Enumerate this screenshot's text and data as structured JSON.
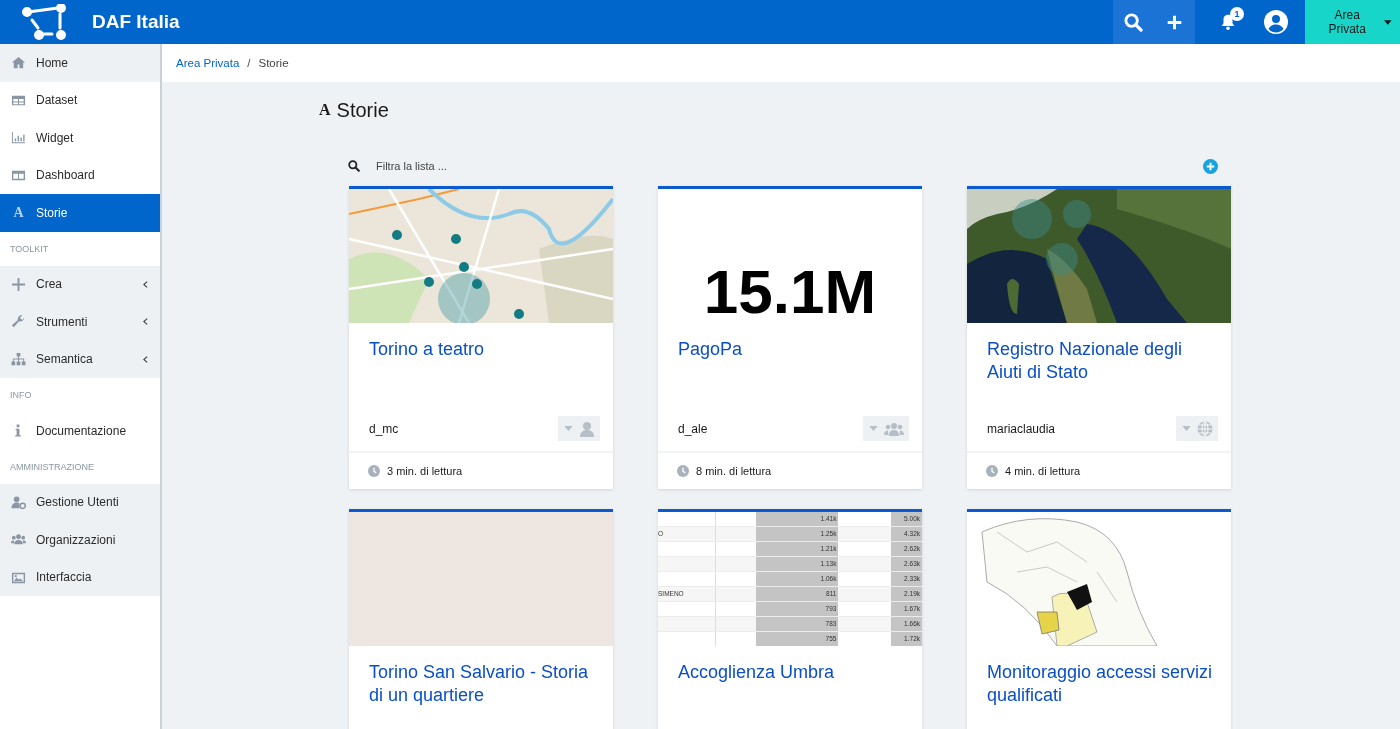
{
  "topbar": {
    "brand": "DAF Italia",
    "notifications": "1",
    "area_menu": "Area Privata"
  },
  "sidebar": {
    "sections": [
      {
        "items": [
          {
            "label": "Home",
            "selected": false,
            "highlighted": true,
            "expandable": false
          },
          {
            "label": "Dataset",
            "selected": false,
            "highlighted": false,
            "expandable": false
          },
          {
            "label": "Widget",
            "selected": false,
            "highlighted": false,
            "expandable": false
          },
          {
            "label": "Dashboard",
            "selected": false,
            "highlighted": false,
            "expandable": false
          },
          {
            "label": "Storie",
            "glyph": "A",
            "selected": true,
            "expandable": false
          }
        ]
      },
      {
        "heading": "TOOLKIT",
        "items": [
          {
            "label": "Crea",
            "selected": false,
            "highlighted": true,
            "expandable": true
          },
          {
            "label": "Strumenti",
            "selected": false,
            "highlighted": true,
            "expandable": true
          },
          {
            "label": "Semantica",
            "selected": false,
            "highlighted": true,
            "expandable": true
          }
        ]
      },
      {
        "heading": "INFO",
        "items": [
          {
            "label": "Documentazione",
            "selected": false,
            "highlighted": false,
            "expandable": false
          }
        ]
      },
      {
        "heading": "AMMINISTRAZIONE",
        "items": [
          {
            "label": "Gestione Utenti",
            "selected": false,
            "highlighted": true,
            "expandable": false
          },
          {
            "label": "Organizzazioni",
            "selected": false,
            "highlighted": true,
            "expandable": false
          },
          {
            "label": "Interfaccia",
            "selected": false,
            "highlighted": true,
            "expandable": false
          }
        ]
      }
    ]
  },
  "breadcrumb": [
    {
      "label": "Area Privata",
      "link": true
    },
    {
      "label": "Storie",
      "link": false
    }
  ],
  "breadcrumb_separator": "/",
  "page_title": {
    "glyph": "A",
    "text": "Storie"
  },
  "search": {
    "placeholder": "Filtra la lista ..."
  },
  "cards": [
    {
      "image": {
        "kind": "map"
      },
      "title": "Torino a teatro",
      "owner": "d_mc",
      "visibility": {
        "kind": "user"
      },
      "reading_time": "3 min. di lettura"
    },
    {
      "image": {
        "kind": "number",
        "value": "15.1M"
      },
      "title": "PagoPa",
      "owner": "d_ale",
      "visibility": {
        "kind": "group"
      },
      "reading_time": "8 min. di lettura"
    },
    {
      "image": {
        "kind": "satellite"
      },
      "title": "Registro Nazionale degli Aiuti di Stato",
      "owner": "mariaclaudia",
      "visibility": {
        "kind": "globe"
      },
      "reading_time": "4 min. di lettura"
    },
    {
      "image": {
        "kind": "plain"
      },
      "title": "Torino San Salvario - Storia di un quartiere"
    },
    {
      "image": {
        "kind": "table",
        "rows": [
          {
            "column_2": "1.41k",
            "column_3": "5.00k"
          },
          {
            "column_1": "O",
            "column_2": "1.25k",
            "column_3": "4.32k"
          },
          {
            "column_2": "1.21k",
            "column_3": "2.62k"
          },
          {
            "column_2": "1.13k",
            "column_3": "2.63k"
          },
          {
            "column_2": "1.06k",
            "column_3": "2.33k"
          },
          {
            "column_1": "SIMENO",
            "column_2": "811",
            "column_3": "2.19k"
          },
          {
            "column_2": "793",
            "column_3": "1.67k"
          },
          {
            "column_2": "783",
            "column_3": "1.66k"
          },
          {
            "column_2": "755",
            "column_3": "1.72k"
          }
        ]
      },
      "title": "Accoglienza Umbra"
    },
    {
      "image": {
        "kind": "choropleth"
      },
      "title": "Monitoraggio accessi servizi qualificati"
    }
  ]
}
